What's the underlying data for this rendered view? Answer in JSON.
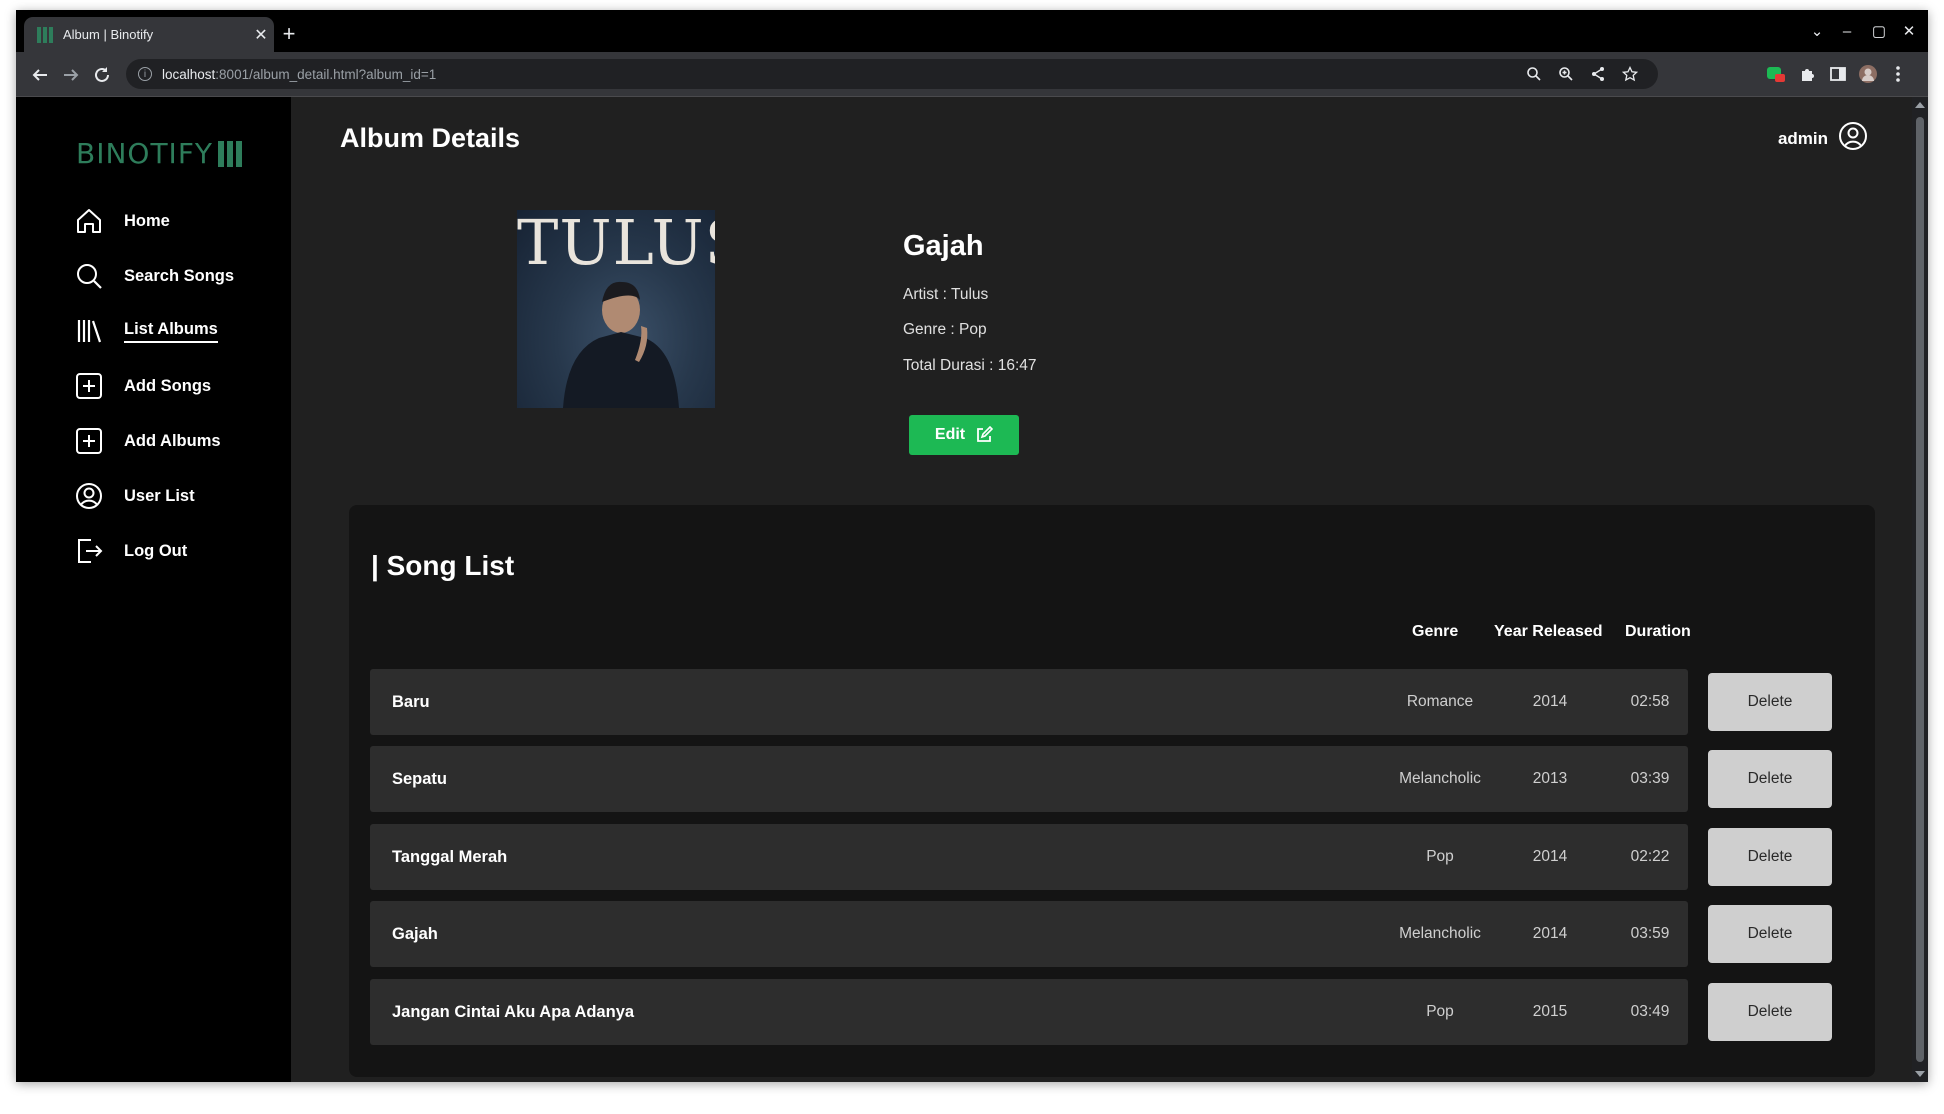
{
  "browser": {
    "tab_title": "Album | Binotify",
    "url_host": "localhost",
    "url_rest": ":8001/album_detail.html?album_id=1"
  },
  "sidebar": {
    "logo": "BINOTIFY",
    "items": [
      {
        "label": "Home",
        "icon": "home-icon"
      },
      {
        "label": "Search Songs",
        "icon": "search-icon"
      },
      {
        "label": "List Albums",
        "icon": "library-icon",
        "active": true
      },
      {
        "label": "Add Songs",
        "icon": "plus-square-icon"
      },
      {
        "label": "Add Albums",
        "icon": "plus-square-icon"
      },
      {
        "label": "User List",
        "icon": "user-circle-icon"
      },
      {
        "label": "Log Out",
        "icon": "logout-icon"
      }
    ]
  },
  "header": {
    "title": "Album Details",
    "username": "admin"
  },
  "album": {
    "cover_text": "TULUS",
    "title": "Gajah",
    "artist": "Artist : Tulus",
    "genre": "Genre : Pop",
    "total_duration": "Total Durasi : 16:47",
    "edit_label": "Edit"
  },
  "song_list": {
    "title": "| Song List",
    "columns": {
      "genre": "Genre",
      "year": "Year Released",
      "duration": "Duration"
    },
    "delete_label": "Delete",
    "rows": [
      {
        "title": "Baru",
        "genre": "Romance",
        "year": "2014",
        "duration": "02:58"
      },
      {
        "title": "Sepatu",
        "genre": "Melancholic",
        "year": "2013",
        "duration": "03:39"
      },
      {
        "title": "Tanggal Merah",
        "genre": "Pop",
        "year": "2014",
        "duration": "02:22"
      },
      {
        "title": "Gajah",
        "genre": "Melancholic",
        "year": "2014",
        "duration": "03:59"
      },
      {
        "title": "Jangan Cintai Aku Apa Adanya",
        "genre": "Pop",
        "year": "2015",
        "duration": "03:49"
      }
    ]
  },
  "colors": {
    "accent": "#1db954",
    "brand": "#2e7d5b"
  }
}
